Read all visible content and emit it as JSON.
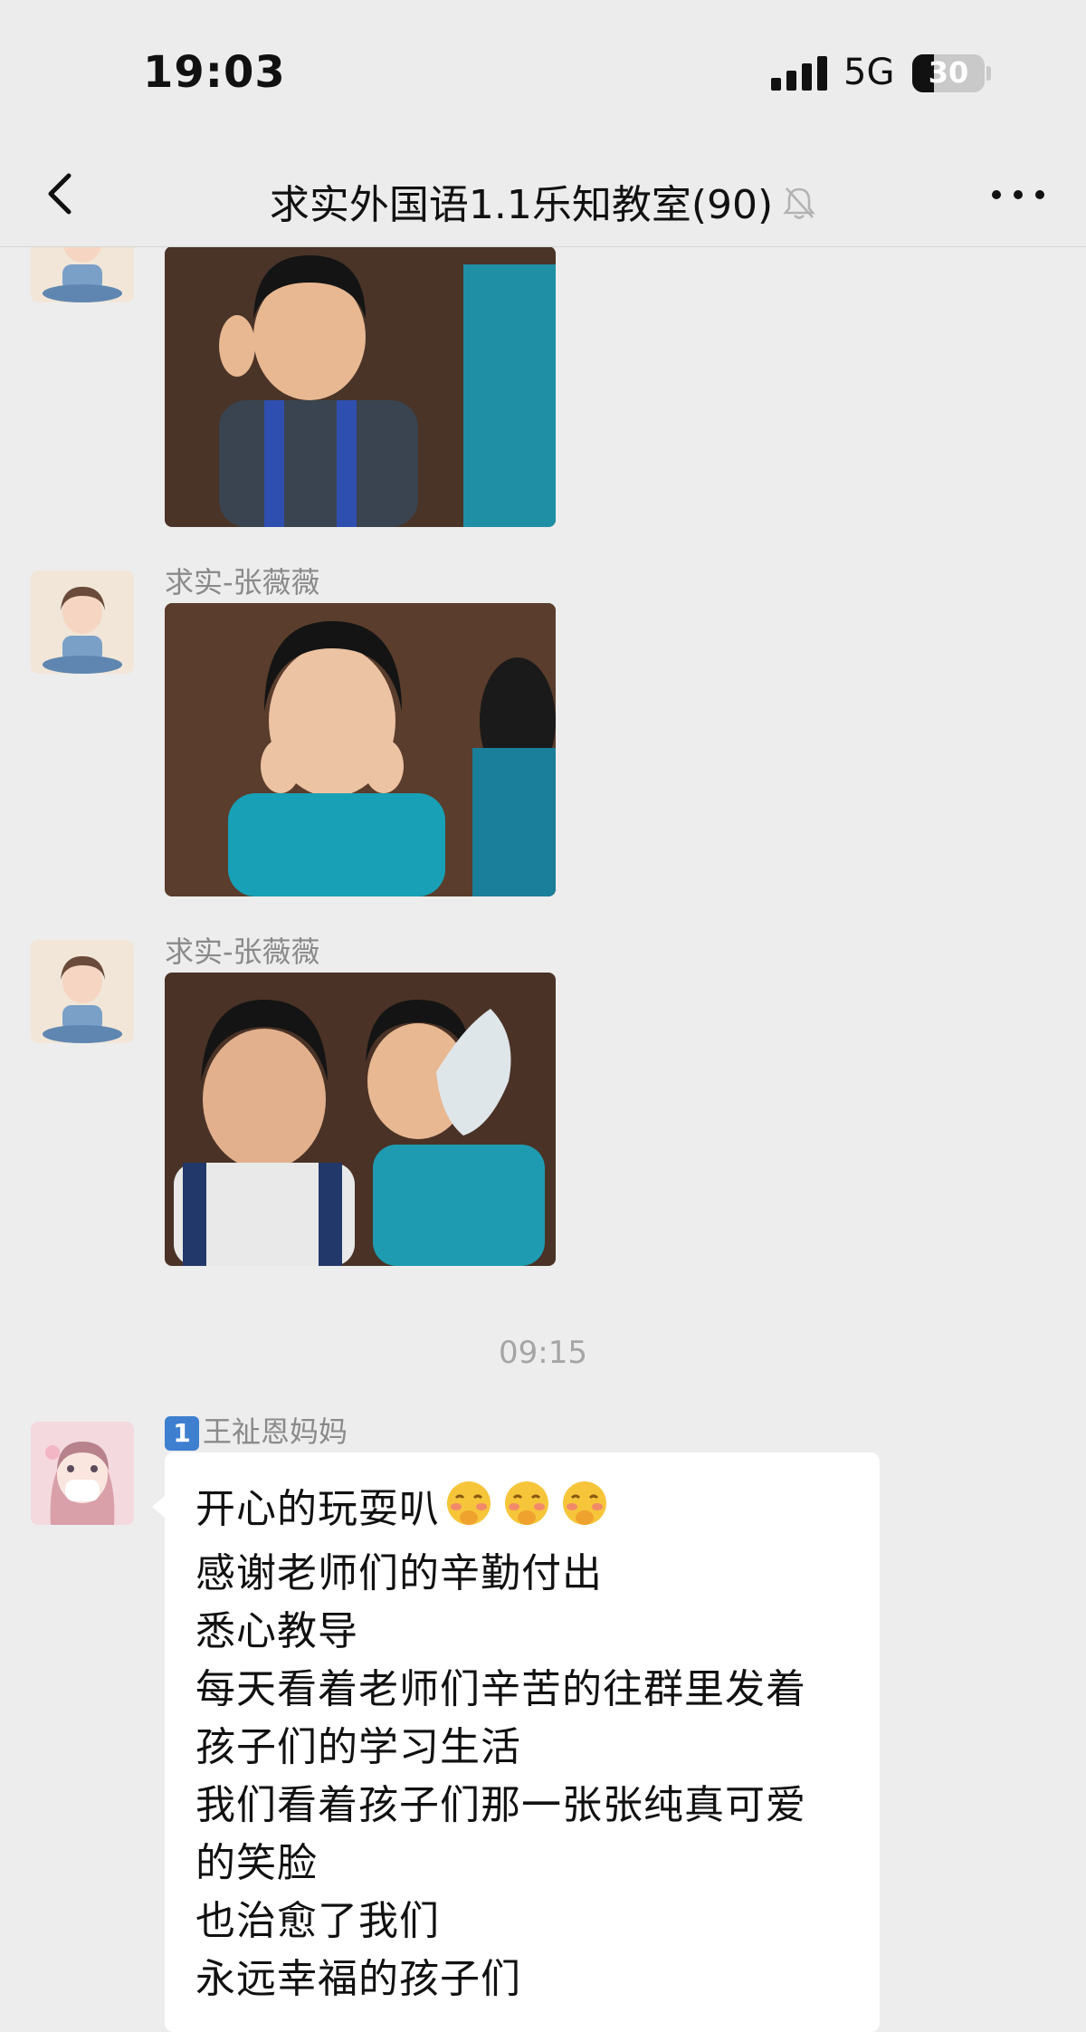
{
  "status": {
    "time": "19:03",
    "network": "5G",
    "battery": "30"
  },
  "header": {
    "title": "求实外国语1.1乐知教室(90)",
    "back_icon": "chevron-left-icon",
    "mute_icon": "bell-off-icon",
    "more_icon": "more-dots-icon"
  },
  "messages": [
    {
      "sender": "求实-张薇薇",
      "type": "image",
      "photo": "two children in teal school uniforms posing on a brown sofa"
    },
    {
      "sender": "求实-张薇薇",
      "type": "image",
      "photo": "two boys smiling, one holding a white glove"
    },
    {
      "timestamp": "09:15"
    },
    {
      "sender_badge": "1",
      "sender": "王祉恩妈妈",
      "type": "text",
      "lines": [
        "开心的玩耍叭",
        "感谢老师们的辛勤付出",
        "悉心教导",
        "每天看着老师们辛苦的往群里发着",
        "孩子们的学习生活",
        "我们看着孩子们那一张张纯真可爱",
        "的笑脸",
        "也治愈了我们",
        "永远幸福的孩子们"
      ],
      "emoji": "blushing-face-emoji"
    }
  ],
  "colors": {
    "background": "#ededed",
    "bubble": "#ffffff",
    "badge": "#3f7fd0"
  }
}
